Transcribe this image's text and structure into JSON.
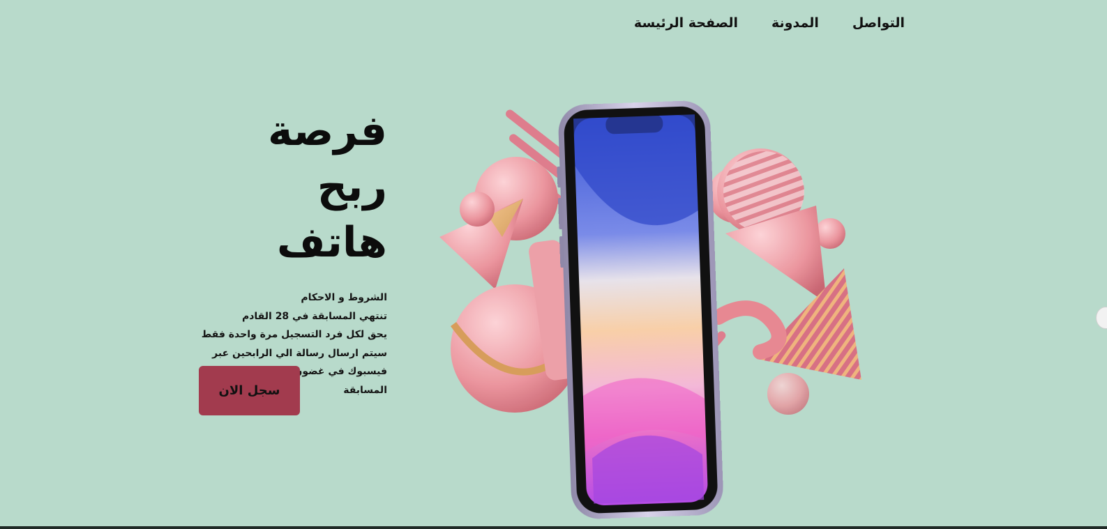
{
  "nav": {
    "items": [
      {
        "label": "التواصل"
      },
      {
        "label": "المدونة"
      },
      {
        "label": "الصفحة الرئيسة"
      }
    ]
  },
  "hero": {
    "title_line1": "فرصة ربح",
    "title_line2": "هاتف",
    "terms": [
      "الشروط و الاحكام",
      "تنتهي المسابقة في 28 القادم",
      "يحق لكل فرد التسجيل مرة واحدة فقط",
      "سيتم ارسال رسالة الي الرابحين عبر",
      "فيسبوك في غضون ثلاث ايام من انتهاء",
      "المسابقة"
    ],
    "cta_label": "سجل الان"
  },
  "colors": {
    "background": "#b8dacb",
    "accent": "#a23b4e",
    "pink": "#e98b95",
    "phone_frame": "#b9b3cf"
  },
  "icons": {
    "illustration": "phone-with-3d-shapes-illustration"
  }
}
